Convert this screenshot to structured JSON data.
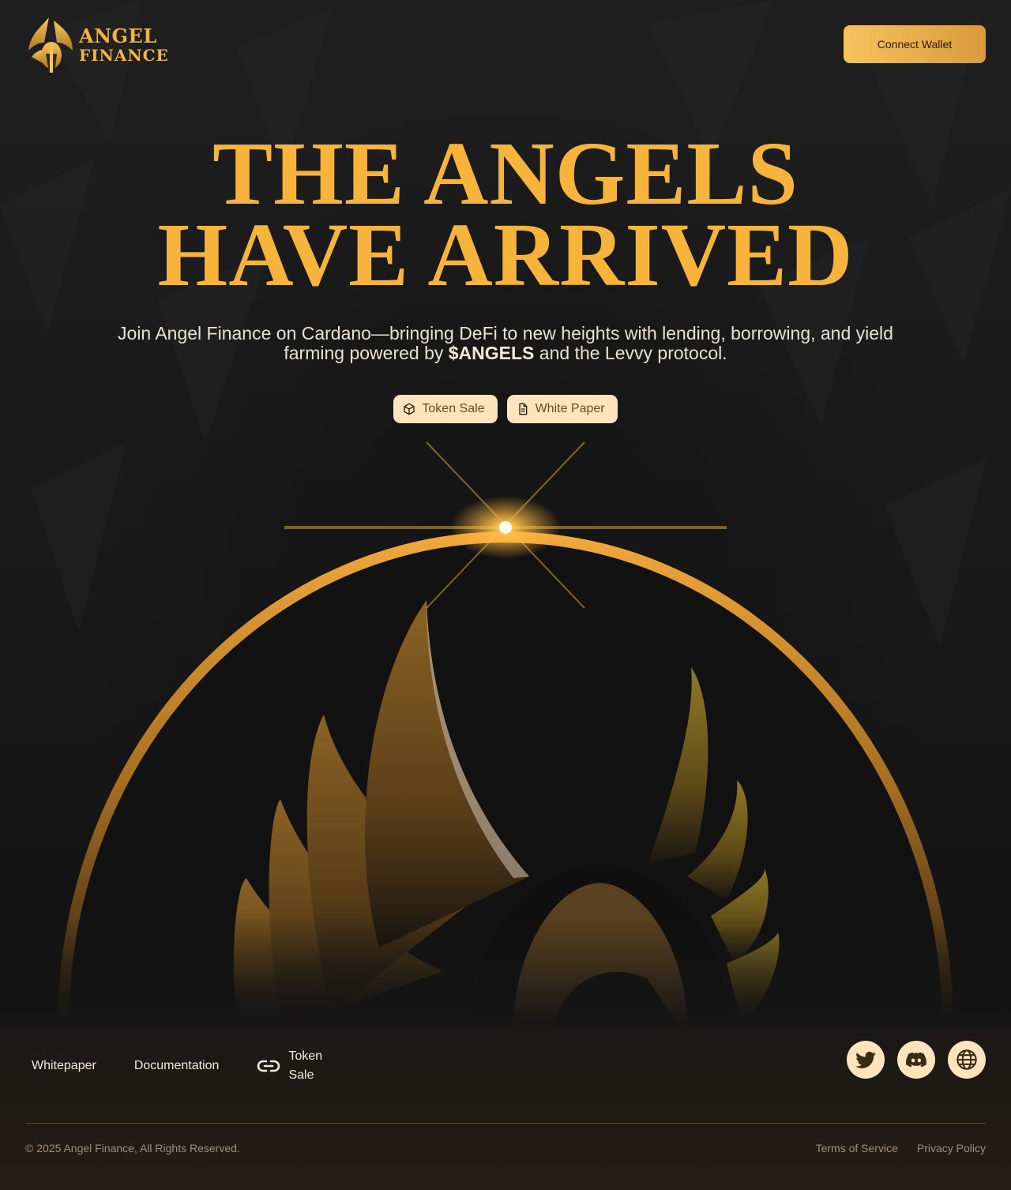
{
  "header": {
    "logo_line1": "ANGEL",
    "logo_line2": "FINANCE",
    "connect_label": "Connect Wallet"
  },
  "hero": {
    "title_line1": "THE ANGELS",
    "title_line2": "HAVE ARRIVED",
    "subtitle_part1": "Join Angel Finance on Cardano—bringing DeFi to new heights with lending, borrowing, and yield farming powered by ",
    "subtitle_token": "$ANGELS",
    "subtitle_part2": " and the Levvy protocol.",
    "actions": [
      {
        "label": "Token Sale",
        "icon": "cube-icon"
      },
      {
        "label": "White Paper",
        "icon": "document-icon"
      }
    ]
  },
  "footer": {
    "links": [
      {
        "label": "Whitepaper"
      },
      {
        "label": "Documentation"
      },
      {
        "label": "Token Sale",
        "icon": "link-icon"
      }
    ],
    "socials": [
      "twitter-icon",
      "discord-icon",
      "globe-icon"
    ],
    "copyright": "© 2025 Angel Finance, All Rights Reserved.",
    "legal": [
      {
        "label": "Terms of Service"
      },
      {
        "label": "Privacy Policy"
      }
    ]
  },
  "colors": {
    "accent": "#f6b43d",
    "pill_bg": "#fde4bd",
    "background": "#1c1c1c"
  }
}
